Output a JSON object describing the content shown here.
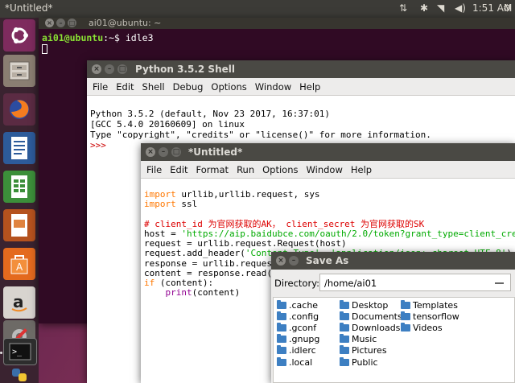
{
  "topbar": {
    "title": "*Untitled*",
    "time": "1:51 AM",
    "indicators": [
      "sort-icon",
      "bluetooth-icon",
      "wifi-icon",
      "volume-icon",
      "gear-icon"
    ]
  },
  "launcher": {
    "apps": [
      "ubuntu-dash",
      "files",
      "firefox",
      "libreoffice-writer",
      "libreoffice-calc",
      "libreoffice-impress",
      "software-center",
      "amazon",
      "system-settings",
      "terminal",
      "python"
    ]
  },
  "terminal": {
    "title": "ai01@ubuntu: ~",
    "prompt_user": "ai01@ubuntu",
    "prompt_rest": ":~$ ",
    "command": "idle3"
  },
  "shell": {
    "title": "Python 3.5.2 Shell",
    "menu": [
      "File",
      "Edit",
      "Shell",
      "Debug",
      "Options",
      "Window",
      "Help"
    ],
    "lines": [
      "Python 3.5.2 (default, Nov 23 2017, 16:37:01)",
      "[GCC 5.4.0 20160609] on linux",
      "Type \"copyright\", \"credits\" or \"license()\" for more information."
    ],
    "prompt": ">>>"
  },
  "editor": {
    "title": "*Untitled*",
    "menu": [
      "File",
      "Edit",
      "Format",
      "Run",
      "Options",
      "Window",
      "Help"
    ],
    "code": {
      "l1_kw": "import",
      "l1_rest": " urllib,urllib.request, sys",
      "l2_kw": "import",
      "l2_rest": " ssl",
      "l4_comment": "# client_id 为官网获取的AK， client_secret 为官网获取的SK",
      "l5_a": "host = ",
      "l5_str": "'https://aip.baidubce.com/oauth/2.0/token?grant_type=client_crede",
      "l6": "request = urllib.request.Request(host)",
      "l7_a": "request.add_header(",
      "l7_s1": "'Content-Type'",
      "l7_b": ", ",
      "l7_s2": "'application/json; charset=UTF-8'",
      "l7_c": ")",
      "l8": "response = urllib.request",
      "l9": "content = response.read(",
      "l10_kw": "if",
      "l10_rest": " (content):",
      "l11_indent": "    ",
      "l11_bi": "print",
      "l11_rest": "(content)"
    }
  },
  "saveas": {
    "title": "Save As",
    "directory_label": "Directory:",
    "directory_value": "/home/ai01",
    "columns": [
      [
        ".cache",
        ".config",
        ".gconf",
        ".gnupg",
        ".idlerc",
        ".local"
      ],
      [
        "Desktop",
        "Documents",
        "Downloads",
        "Music",
        "Pictures",
        "Public"
      ],
      [
        "Templates",
        "tensorflow",
        "Videos"
      ]
    ]
  },
  "colors": {
    "accent": "#e95420",
    "terminal_bg": "#300a24",
    "keyword": "#ff7700",
    "string": "#00aa00",
    "comment": "#dd0000",
    "builtin": "#900090"
  }
}
